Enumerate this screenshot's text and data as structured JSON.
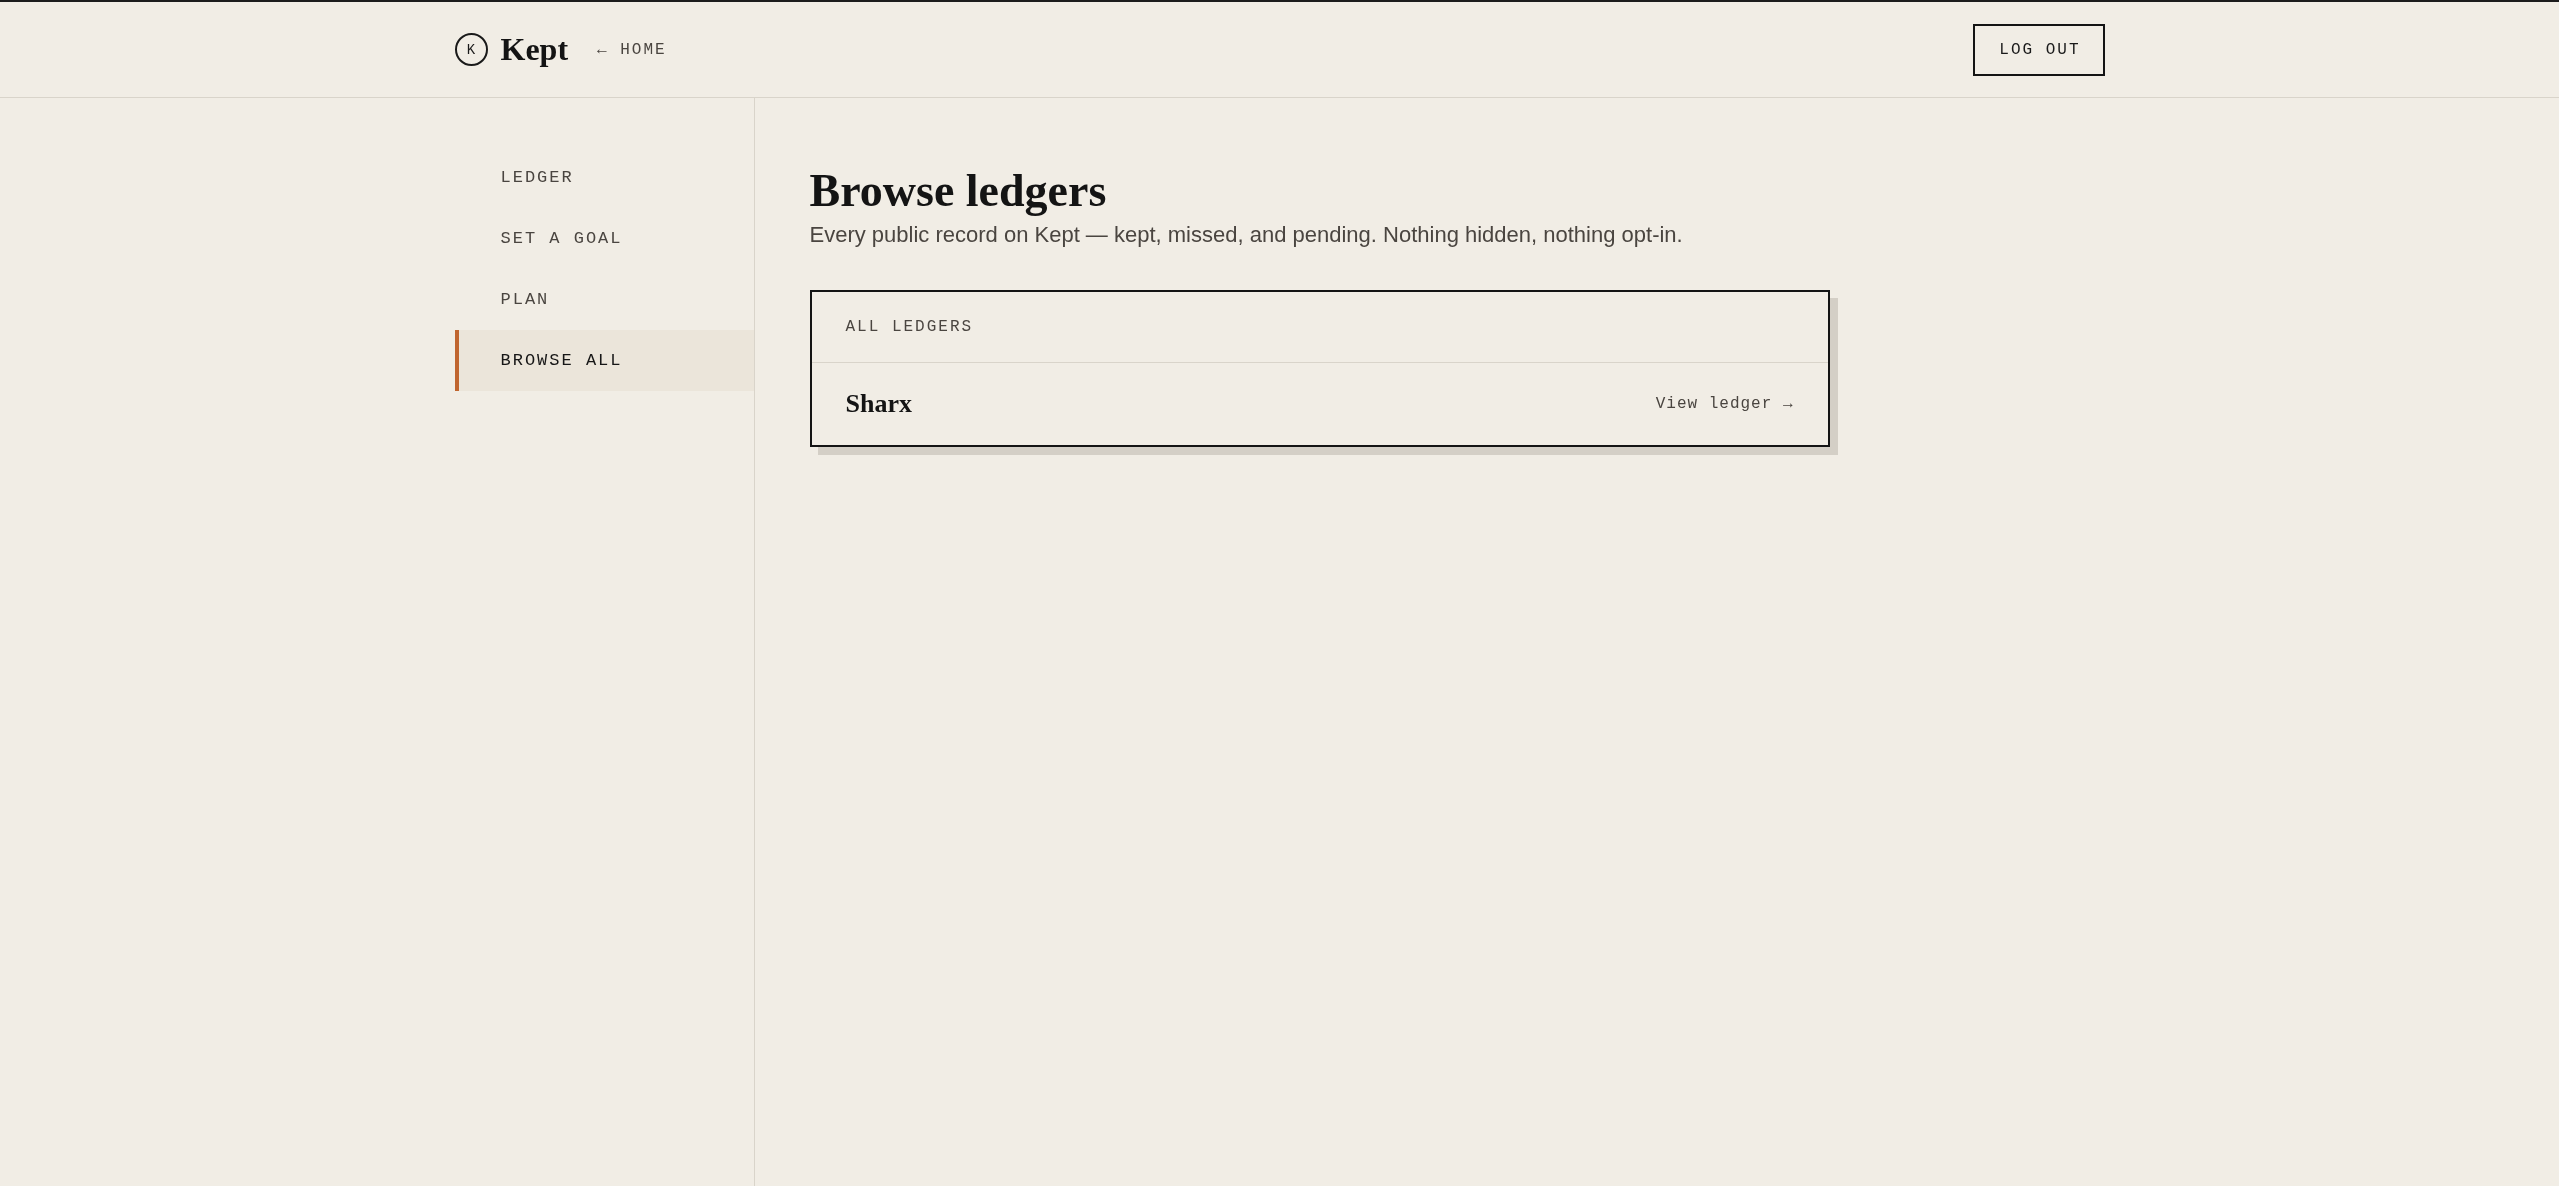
{
  "header": {
    "logo": {
      "mark": "K",
      "name": "Kept"
    },
    "home_link": "← HOME",
    "logout_button": "LOG OUT"
  },
  "sidebar": {
    "items": [
      {
        "label": "LEDGER",
        "selected": false
      },
      {
        "label": "SET A GOAL",
        "selected": false
      },
      {
        "label": "PLAN",
        "selected": false
      },
      {
        "label": "BROWSE ALL",
        "selected": true
      }
    ]
  },
  "main": {
    "title": "Browse ledgers",
    "subtitle": "Every public record on Kept — kept, missed, and pending. Nothing hidden, nothing opt-in.",
    "ledger_list": {
      "heading": "ALL LEDGERS",
      "rows": [
        {
          "name": "Sharx",
          "link": "View ledger →"
        }
      ]
    }
  }
}
